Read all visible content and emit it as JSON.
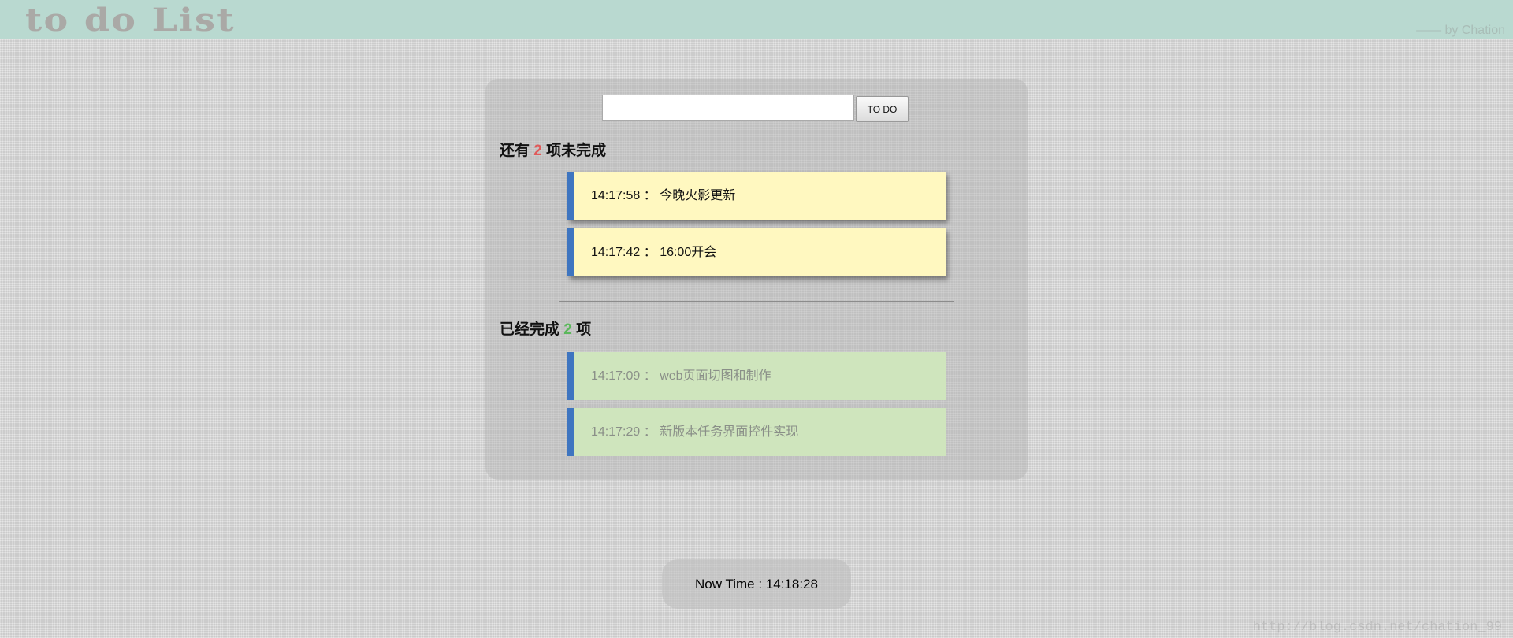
{
  "header": {
    "title": "to do List",
    "byline": "—— by Chation"
  },
  "form": {
    "input_value": "",
    "button_label": "TO DO"
  },
  "pending": {
    "prefix": "还有",
    "count": "2",
    "suffix": "项未完成",
    "items": [
      {
        "time": "14:17:58",
        "text": "今晚火影更新"
      },
      {
        "time": "14:17:42",
        "text": "16:00开会"
      }
    ]
  },
  "done": {
    "prefix": "已经完成",
    "count": "2",
    "suffix": "项",
    "items": [
      {
        "time": "14:17:09",
        "text": "web页面切图和制作"
      },
      {
        "time": "14:17:29",
        "text": "新版本任务界面控件实现"
      }
    ]
  },
  "separator": " ： ",
  "clock": {
    "label": "Now Time : ",
    "time": "14:18:28"
  },
  "watermark": "http://blog.csdn.net/chation_99",
  "colors": {
    "header": "#b9d9d0",
    "accent": "#3e75c0",
    "pending_bg": "#fff8c0",
    "done_bg": "#cfe5bd",
    "pending_count": "#e05a5a",
    "done_count": "#5cb85c"
  }
}
